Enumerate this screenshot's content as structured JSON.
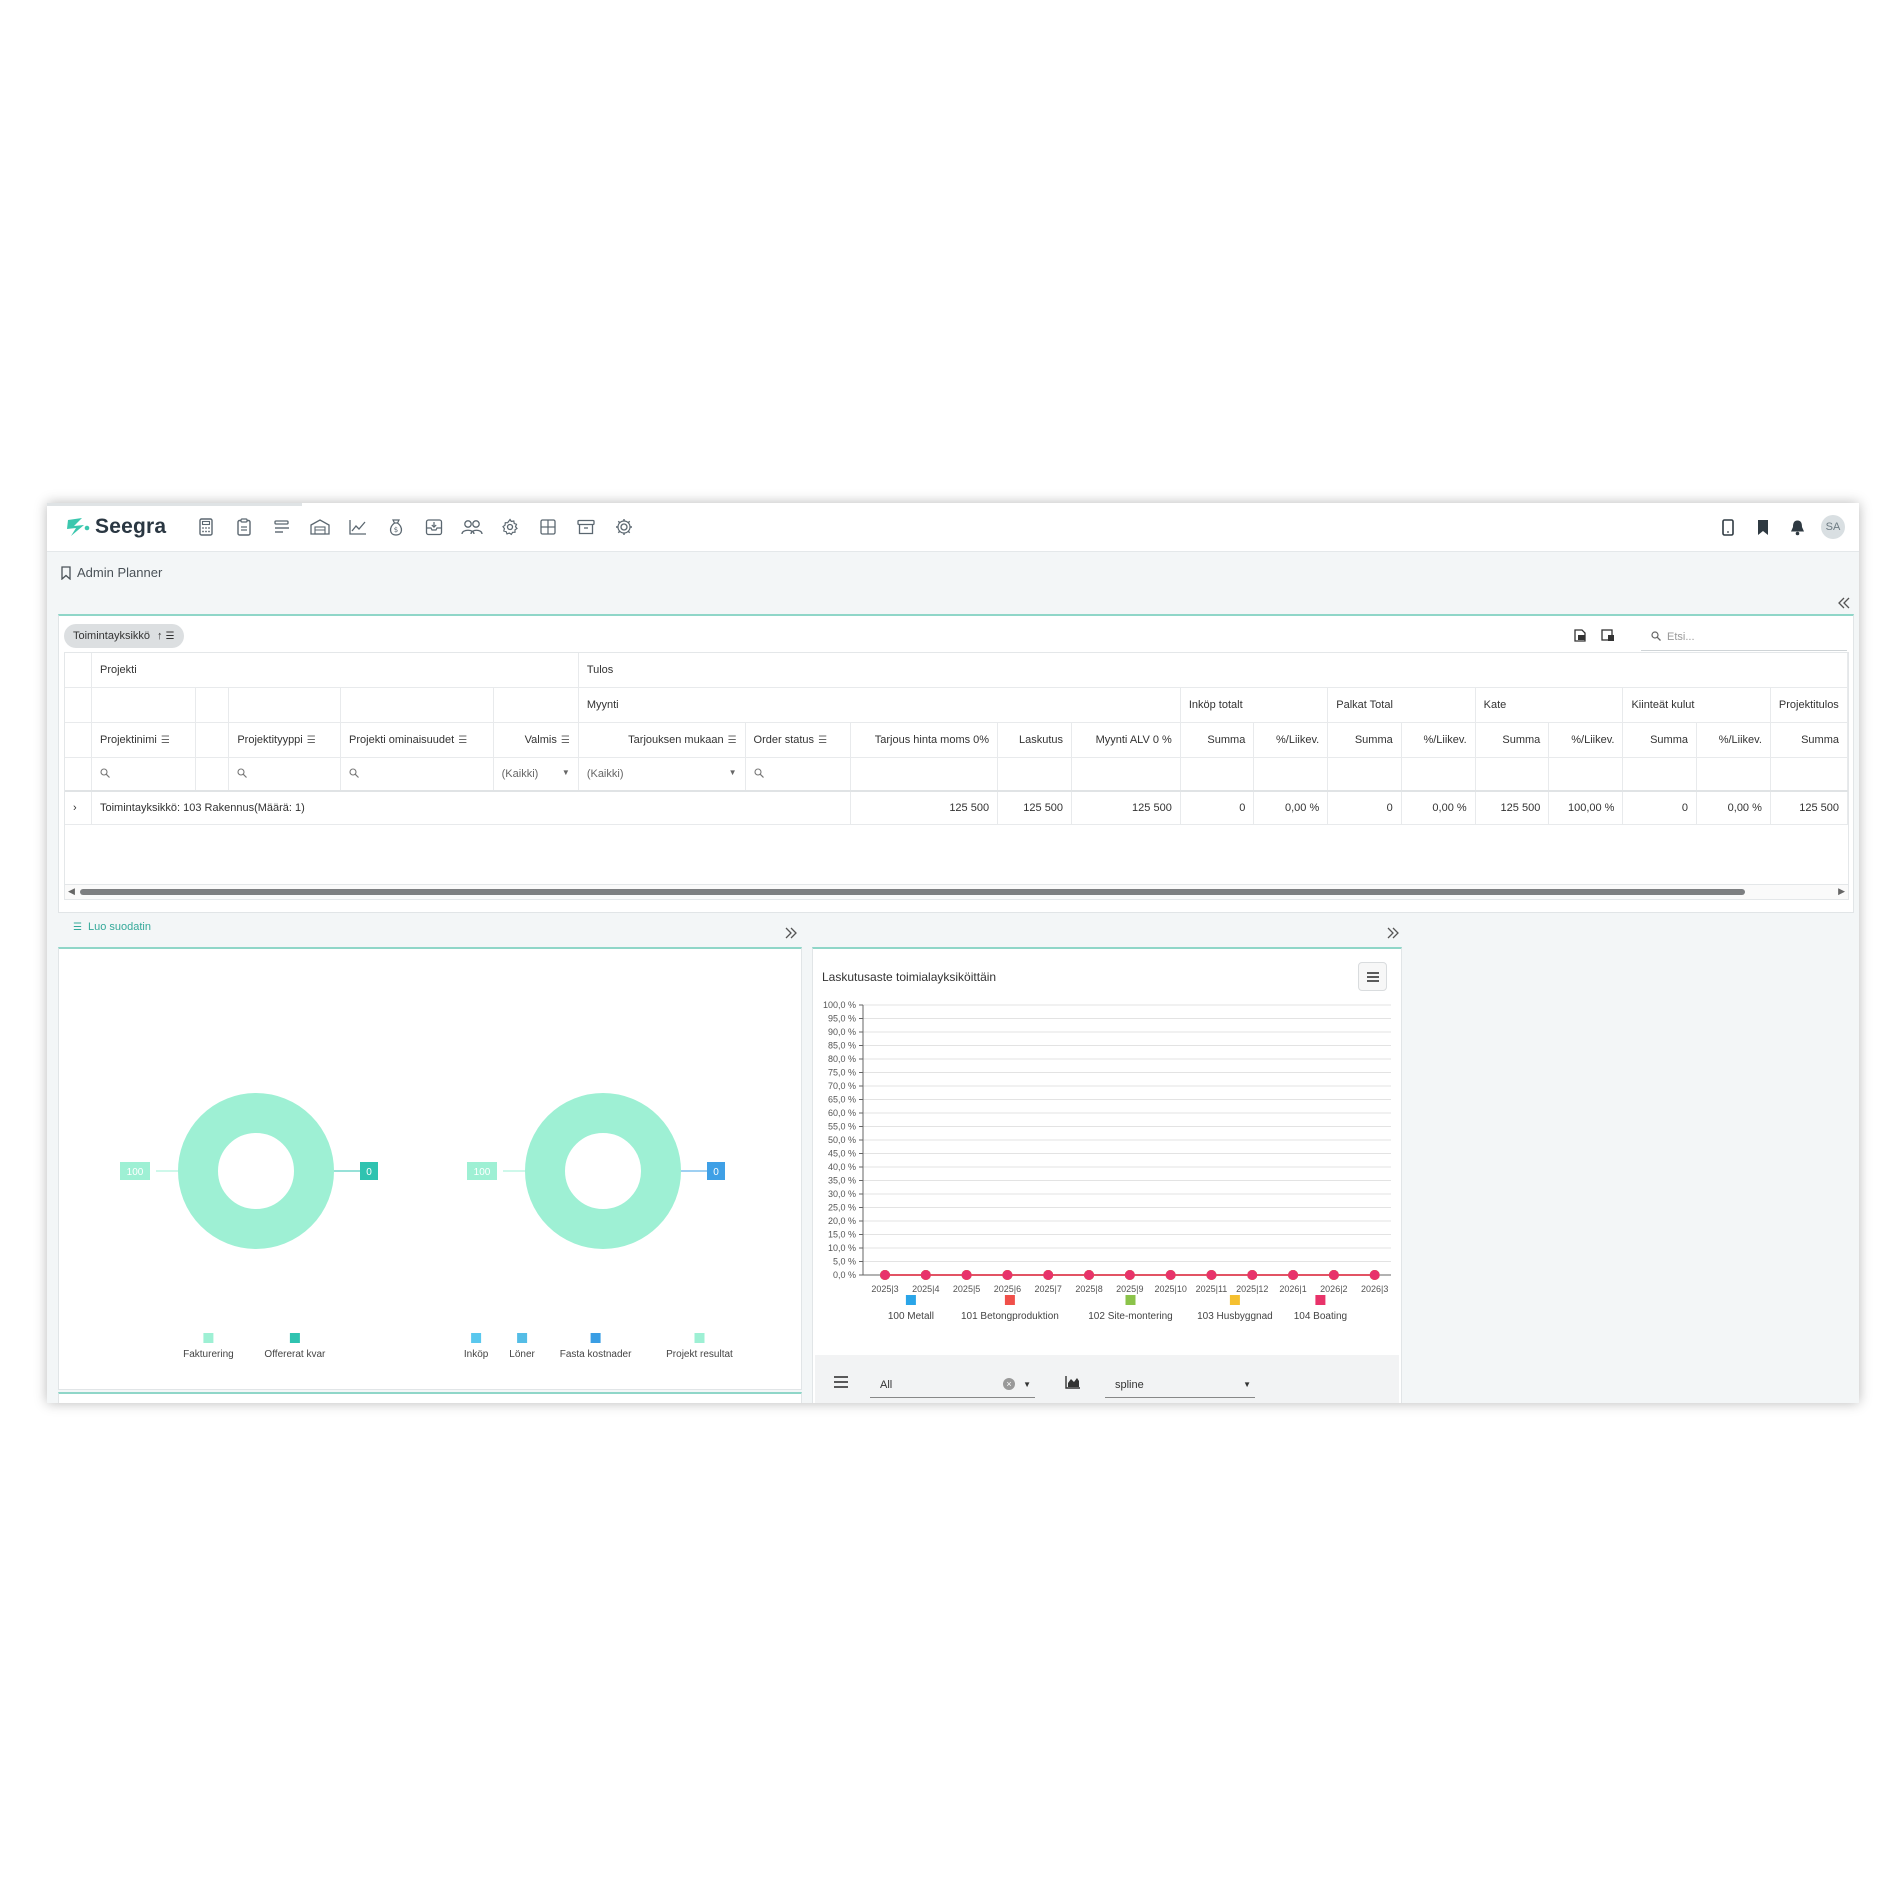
{
  "app": {
    "name": "Seegra",
    "user_initials": "SA"
  },
  "nav_icons": [
    "calculator-icon",
    "clipboard-icon",
    "list-icon",
    "warehouse-icon",
    "line-chart-icon",
    "money-bag-icon",
    "inbox-icon",
    "users-icon",
    "gear-icon",
    "grid-icon",
    "archive-icon",
    "cog-icon"
  ],
  "page": {
    "title": "Admin Planner"
  },
  "grid": {
    "group_chip": "Toimintayksikkö",
    "search_placeholder": "Etsi...",
    "header_groups": {
      "projekti": "Projekti",
      "tulos": "Tulos"
    },
    "subgroups": {
      "myynti": "Myynti",
      "inkop": "Inköp totalt",
      "palkat": "Palkat Total",
      "kate": "Kate",
      "kiinteat": "Kiinteät kulut",
      "projektitulos": "Projektitulos"
    },
    "columns": {
      "projektinimi": "Projektinimi",
      "projektityyppi": "Projektityyppi",
      "ominaisuudet": "Projekti ominaisuudet",
      "valmis": "Valmis",
      "tarjouksen": "Tarjouksen mukaan",
      "order_status": "Order status",
      "tarjous_hinta": "Tarjous hinta moms 0%",
      "laskutus": "Laskutus",
      "myynti_alv": "Myynti ALV 0 %",
      "summa": "Summa",
      "liikev": "%/Liikev."
    },
    "filters": {
      "valmis": "(Kaikki)",
      "tarjouksen": "(Kaikki)"
    },
    "group_row": {
      "label": "Toimintayksikkö: 103 Rakennus(Määrä: 1)",
      "tarjous_hinta": "125 500",
      "laskutus": "125 500",
      "myynti_alv": "125 500",
      "inkop_summa": "0",
      "inkop_pct": "0,00 %",
      "palkat_summa": "0",
      "palkat_pct": "0,00 %",
      "kate_summa": "125 500",
      "kate_pct": "100,00 %",
      "kiinteat_summa": "0",
      "kiinteat_pct": "0,00 %",
      "projektitulos_summa": "125 500"
    },
    "create_filter": "Luo suodatin"
  },
  "donuts": [
    {
      "left_label": "100",
      "right_label": "0",
      "color": "#9ef0d4",
      "right_color": "#2fc3b0",
      "legend": [
        {
          "name": "Fakturering",
          "color": "#9ef0d4"
        },
        {
          "name": "Offererat kvar",
          "color": "#2fc3b0"
        }
      ]
    },
    {
      "left_label": "100",
      "right_label": "0",
      "color": "#9ef0d4",
      "right_color": "#3fa0e6",
      "legend": [
        {
          "name": "Inköp",
          "color": "#5ac8ee"
        },
        {
          "name": "Löner",
          "color": "#55bde6"
        },
        {
          "name": "Fasta kostnader",
          "color": "#3a9ee4"
        },
        {
          "name": "Projekt resultat",
          "color": "#9ef0d4"
        }
      ]
    }
  ],
  "chart_data": {
    "type": "line",
    "title": "Laskutusaste toimialayksiköittäin",
    "x": [
      "2025|3",
      "2025|4",
      "2025|5",
      "2025|6",
      "2025|7",
      "2025|8",
      "2025|9",
      "2025|10",
      "2025|11",
      "2025|12",
      "2026|1",
      "2026|2",
      "2026|3"
    ],
    "y_ticks": [
      "0,0 %",
      "5,0 %",
      "10,0 %",
      "15,0 %",
      "20,0 %",
      "25,0 %",
      "30,0 %",
      "35,0 %",
      "40,0 %",
      "45,0 %",
      "50,0 %",
      "55,0 %",
      "60,0 %",
      "65,0 %",
      "70,0 %",
      "75,0 %",
      "80,0 %",
      "85,0 %",
      "90,0 %",
      "95,0 %",
      "100,0 %"
    ],
    "ylim": [
      0,
      100
    ],
    "grid": true,
    "legend_position": "bottom",
    "series": [
      {
        "name": "100 Metall",
        "color": "#2aa5e8",
        "values": [
          0,
          0,
          0,
          0,
          0,
          0,
          0,
          0,
          0,
          0,
          0,
          0,
          0
        ]
      },
      {
        "name": "101 Betongproduktion",
        "color": "#f0504a",
        "values": [
          0,
          0,
          0,
          0,
          0,
          0,
          0,
          0,
          0,
          0,
          0,
          0,
          0
        ]
      },
      {
        "name": "102 Site-montering",
        "color": "#8bc34a",
        "values": [
          0,
          0,
          0,
          0,
          0,
          0,
          0,
          0,
          0,
          0,
          0,
          0,
          0
        ]
      },
      {
        "name": "103 Husbyggnad",
        "color": "#f5c030",
        "values": [
          0,
          0,
          0,
          0,
          0,
          0,
          0,
          0,
          0,
          0,
          0,
          0,
          0
        ]
      },
      {
        "name": "104 Boating",
        "color": "#e8336a",
        "values": [
          0,
          0,
          0,
          0,
          0,
          0,
          0,
          0,
          0,
          0,
          0,
          0,
          0
        ]
      }
    ]
  },
  "chart_controls": {
    "series_select": "All",
    "type_select": "spline"
  }
}
